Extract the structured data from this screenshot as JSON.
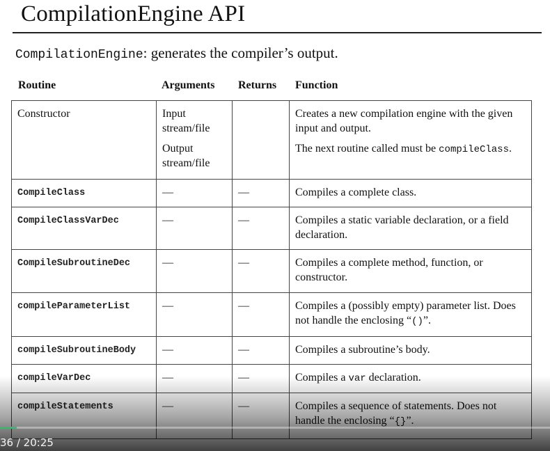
{
  "slide": {
    "title": "CompilationEngine API",
    "subtitle_code": "CompilationEngine",
    "subtitle_text": ": generates the compiler’s output."
  },
  "table": {
    "headers": [
      "Routine",
      "Arguments",
      "Returns",
      "Function"
    ],
    "rows": [
      {
        "routine": "Constructor",
        "args": [
          "Input stream/file",
          "Output stream/file"
        ],
        "returns": "",
        "function_lines": [
          "Creates a new compilation engine with the given input and output."
        ],
        "function_extra_text": "The next routine called must be",
        "function_extra_code": "compileClass",
        "function_extra_end": "."
      },
      {
        "routine": "CompileClass",
        "args": "—",
        "returns": "—",
        "function": "Compiles a complete class."
      },
      {
        "routine": "CompileClassVarDec",
        "args": "—",
        "returns": "—",
        "function": "Compiles a static variable declaration, or a field declaration."
      },
      {
        "routine": "CompileSubroutineDec",
        "args": "—",
        "returns": "—",
        "function": "Compiles a complete method, function, or constructor."
      },
      {
        "routine": "compileParameterList",
        "args": "—",
        "returns": "—",
        "function_a": "Compiles a (possibly empty) parameter list. Does not handle the enclosing “",
        "function_code": "()",
        "function_b": "”."
      },
      {
        "routine": "compileSubroutineBody",
        "args": "—",
        "returns": "—",
        "function": "Compiles a subroutine’s body."
      },
      {
        "routine": "compileVarDec",
        "args": "—",
        "returns": "—",
        "function_a": "Compiles a ",
        "function_code": "var",
        "function_b": " declaration."
      },
      {
        "routine": "compileStatements",
        "args": "—",
        "returns": "—",
        "function_a": "Compiles a sequence of statements. Does not handle the enclosing “",
        "function_code": "{}",
        "function_b": "”."
      }
    ]
  },
  "player": {
    "time_text": "36 / 20:25",
    "progress": 0.03,
    "progress_color": "#2fbf6a"
  }
}
